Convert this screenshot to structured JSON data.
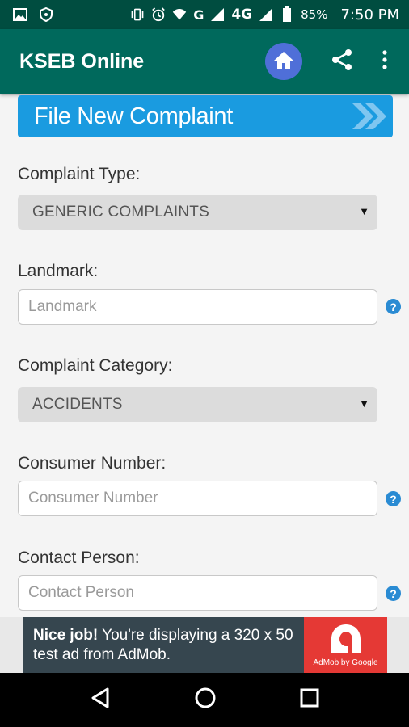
{
  "status_bar": {
    "battery": "85%",
    "time": "7:50 PM",
    "network": "4G",
    "signal_label": "G",
    "icons": [
      "image-icon",
      "shield-icon",
      "vibrate-icon",
      "alarm-icon",
      "wifi-icon",
      "signal-icon",
      "battery-icon"
    ]
  },
  "app_bar": {
    "title": "KSEB Online",
    "actions": [
      "home-icon",
      "share-icon",
      "more-vert-icon"
    ]
  },
  "banner": {
    "label": "File New Complaint"
  },
  "form": {
    "complaint_type": {
      "label": "Complaint Type:",
      "value": "GENERIC COMPLAINTS"
    },
    "landmark": {
      "label": "Landmark:",
      "placeholder": "Landmark"
    },
    "complaint_category": {
      "label": "Complaint Category:",
      "value": "ACCIDENTS"
    },
    "consumer_number": {
      "label": "Consumer Number:",
      "placeholder": "Consumer Number"
    },
    "contact_person": {
      "label": "Contact Person:",
      "placeholder": "Contact Person"
    },
    "help_glyph": "?"
  },
  "ad": {
    "headline": "Nice job!",
    "body": " You're displaying a 320 x 50 test ad from AdMob.",
    "logo_caption": "AdMob by Google"
  },
  "colors": {
    "status_bar": "#004d40",
    "app_bar": "#00695c",
    "banner": "#1a9be0",
    "home_button": "#4f6fd8",
    "ad_background": "#36464f",
    "ad_logo": "#e53935"
  }
}
